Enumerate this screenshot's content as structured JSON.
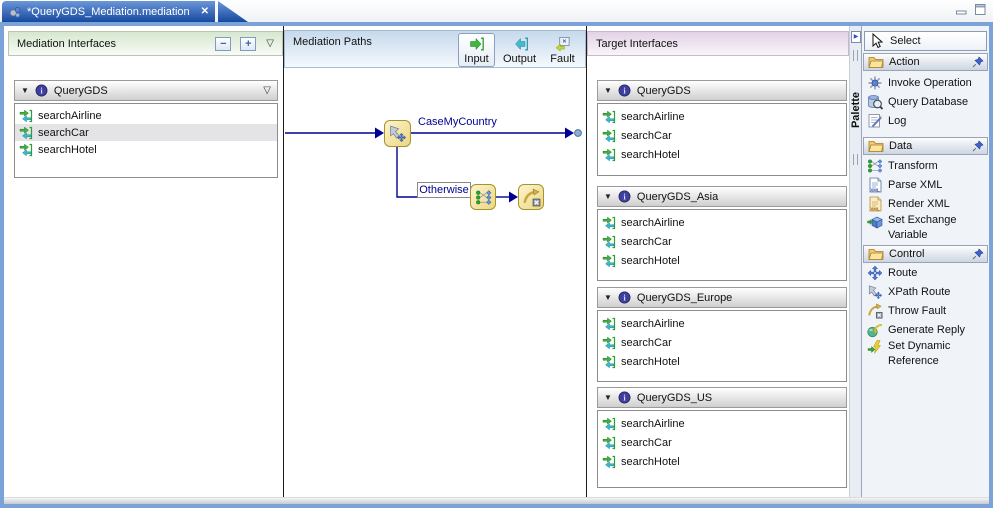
{
  "icons": {
    "close": "✕",
    "collapse_all": "−",
    "expand_all": "+",
    "dropdown": "▽",
    "section_arrow": "▼",
    "palette_arrow": "▶"
  },
  "tab": {
    "title": "*QueryGDS_Mediation.mediation"
  },
  "panels": {
    "interfaces": {
      "title": "Mediation Interfaces",
      "group": {
        "name": "QueryGDS",
        "operations": [
          "searchAirline",
          "searchCar",
          "searchHotel"
        ]
      }
    },
    "paths": {
      "title": "Mediation Paths",
      "toolbar": {
        "input": "Input",
        "output": "Output",
        "fault": "Fault"
      },
      "flow": {
        "case_label": "CaseMyCountry",
        "otherwise_label": "Otherwise"
      }
    },
    "targets": {
      "title": "Target Interfaces",
      "groups": [
        {
          "name": "QueryGDS",
          "operations": [
            "searchAirline",
            "searchCar",
            "searchHotel"
          ]
        },
        {
          "name": "QueryGDS_Asia",
          "operations": [
            "searchAirline",
            "searchCar",
            "searchHotel"
          ]
        },
        {
          "name": "QueryGDS_Europe",
          "operations": [
            "searchAirline",
            "searchCar",
            "searchHotel"
          ]
        },
        {
          "name": "QueryGDS_US",
          "operations": [
            "searchAirline",
            "searchCar",
            "searchHotel"
          ]
        }
      ]
    }
  },
  "palette": {
    "sash_label": "Palette",
    "select_tool": "Select",
    "categories": [
      {
        "label": "Action",
        "items": [
          "Invoke Operation",
          "Query Database",
          "Log"
        ]
      },
      {
        "label": "Data",
        "items": [
          "Transform",
          "Parse XML",
          "Render XML",
          "Set Exchange Variable"
        ]
      },
      {
        "label": "Control",
        "items": [
          "Route",
          "XPath Route",
          "Throw Fault",
          "Generate Reply",
          "Set Dynamic Reference"
        ]
      }
    ]
  },
  "colors": {
    "frame_border": "#7ba3d7",
    "tab_gradient_top": "#6b97d9",
    "tab_gradient_bottom": "#16489e",
    "flow_line": "#000090",
    "node_fill": "#f6e9b0",
    "node_border": "#a8922e",
    "header_green": "#d6e7cf",
    "header_blue": "#c6d9ec",
    "header_pink": "#e3d2e6",
    "selected_row": "#e4e4e6"
  }
}
